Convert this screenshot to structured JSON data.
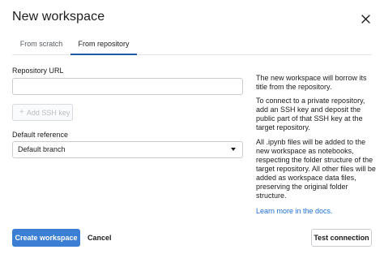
{
  "dialog": {
    "title": "New workspace",
    "close_icon": "close-icon"
  },
  "tabs": [
    {
      "label": "From scratch",
      "active": false
    },
    {
      "label": "From repository",
      "active": true
    }
  ],
  "form": {
    "repository_url": {
      "label": "Repository URL",
      "value": "",
      "placeholder": ""
    },
    "ssh_button": {
      "icon": "plus-icon",
      "label": "Add SSH key",
      "disabled": true
    },
    "default_reference": {
      "label": "Default reference",
      "selected": "Default branch"
    }
  },
  "help": {
    "p1": "The new workspace will borrow its title from the repository.",
    "p2": "To connect to a private repository, add an SSH key and deposit the public part of that SSH key at the target repository.",
    "p3": "All .ipynb files will be added to the new workspace as notebooks, respecting the folder structure of the target repository. All other files will be added as workspace data files, preserving the original folder structure.",
    "link": "Learn more in the docs."
  },
  "footer": {
    "create_label": "Create workspace",
    "cancel_label": "Cancel",
    "test_label": "Test connection"
  },
  "colors": {
    "primary": "#3b7fd4",
    "link": "#1e6fd9",
    "active_tab_underline": "#1e5aa8"
  }
}
